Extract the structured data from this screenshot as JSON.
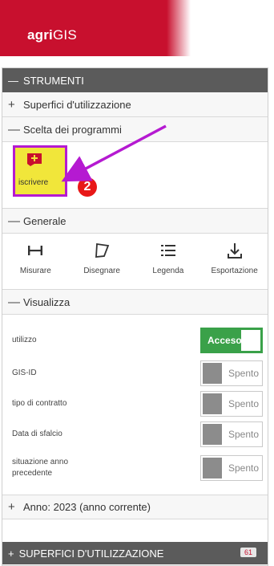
{
  "brand": {
    "name_bold": "agri",
    "name_light": "GIS"
  },
  "panel": {
    "header": {
      "sign": "—",
      "label": "STRUMENTI"
    },
    "superfici": {
      "sign": "+",
      "label": "Superfici d'utilizzazione"
    },
    "scelta": {
      "sign": "—",
      "label": "Scelta dei programmi",
      "tile_label": "iscrivere",
      "annotation_number": "2"
    },
    "generale": {
      "sign": "—",
      "label": "Generale",
      "tools": [
        {
          "icon": "measure-icon",
          "label": "Misurare"
        },
        {
          "icon": "draw-polygon-icon",
          "label": "Disegnare"
        },
        {
          "icon": "list-icon",
          "label": "Legenda"
        },
        {
          "icon": "download-icon",
          "label": "Esportazione"
        }
      ]
    },
    "visualizza": {
      "sign": "—",
      "label": "Visualizza",
      "layers": [
        {
          "label": "utilizzo",
          "state": "Acceso",
          "on": true
        },
        {
          "label": "GIS-ID",
          "state": "Spento",
          "on": false
        },
        {
          "label": "tipo di contratto",
          "state": "Spento",
          "on": false
        },
        {
          "label": "Data di sfalcio",
          "state": "Spento",
          "on": false
        },
        {
          "label": "situazione anno precedente",
          "state": "Spento",
          "on": false
        }
      ]
    },
    "anno": {
      "sign": "+",
      "label": "Anno: 2023 (anno corrente)"
    },
    "footer": {
      "sign": "+",
      "label": "SUPERFICI D'UTILIZZAZIONE",
      "count": "61"
    }
  },
  "colors": {
    "brand_red": "#c8102e",
    "header_gray": "#5b5b5b",
    "toggle_on": "#3aa149",
    "highlight_yellow": "#f1e63a",
    "annotation_purple": "#b51ad1",
    "badge_red": "#e81818"
  }
}
